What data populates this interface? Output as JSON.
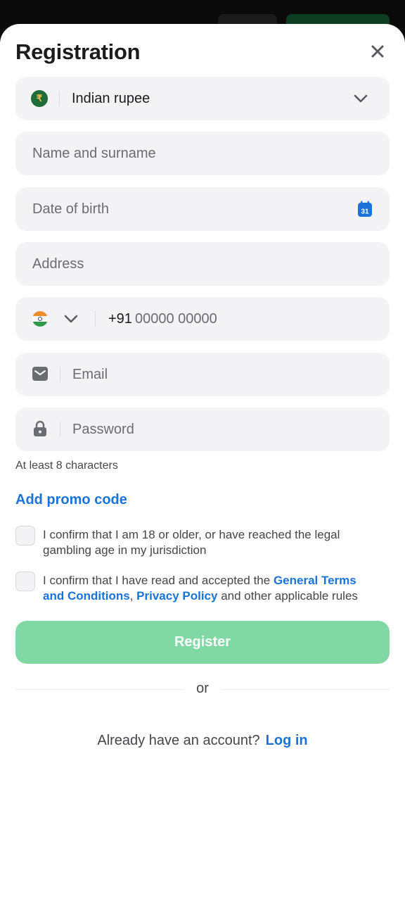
{
  "header": {
    "title": "Registration",
    "close_icon": "close-icon"
  },
  "currency": {
    "icon": "rupee-coin-icon",
    "symbol": "₹",
    "value": "Indian rupee",
    "chevron_icon": "chevron-down-icon"
  },
  "fields": {
    "name_placeholder": "Name and surname",
    "dob_placeholder": "Date of birth",
    "calendar_day": "31",
    "address_placeholder": "Address",
    "phone_country_code": "+91",
    "phone_placeholder": "00000 00000",
    "email_placeholder": "Email",
    "password_placeholder": "Password"
  },
  "password_hint": "At least 8 characters",
  "promo_link": "Add promo code",
  "consents": {
    "age": "I confirm that I am 18 or older, or have reached the legal gambling age in my jurisdiction",
    "terms_prefix": "I confirm that I have read and accepted the ",
    "terms_link": "General Terms and Conditions",
    "terms_sep": ", ",
    "privacy_link": "Privacy Policy",
    "terms_suffix": " and other applicable rules"
  },
  "register_button": "Register",
  "or_label": "or",
  "login": {
    "prompt": "Already have an account?",
    "link": "Log in"
  },
  "colors": {
    "accent_blue": "#1a73d9",
    "register_green": "#80d9a4",
    "field_bg": "#f3f3f5"
  }
}
